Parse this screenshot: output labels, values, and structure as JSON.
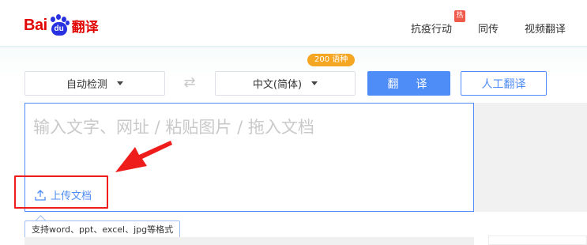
{
  "header": {
    "logo_bai": "Bai",
    "logo_du": "du",
    "logo_translate": "翻译",
    "nav": [
      {
        "label": "抗疫行动",
        "badge": "热"
      },
      {
        "label": "同传"
      },
      {
        "label": "视频翻译"
      }
    ]
  },
  "toolbar": {
    "source_lang": "自动检测",
    "target_lang": "中文(简体)",
    "lang_count_badge": "200 语种",
    "translate_button": "翻　译",
    "human_translate_button": "人工翻译",
    "swap_icon": "swap-arrows-icon"
  },
  "input": {
    "placeholder": "输入文字、网址 / 粘贴图片 / 拖入文档",
    "upload_label": "上传文档",
    "upload_tooltip": "支持word、ppt、excel、jpg等格式"
  },
  "colors": {
    "brand_red": "#e10602",
    "brand_blue": "#2932e1",
    "accent": "#4e8cf7",
    "badge_orange": "#f5a623",
    "annotation_red": "#ef1c1c"
  }
}
